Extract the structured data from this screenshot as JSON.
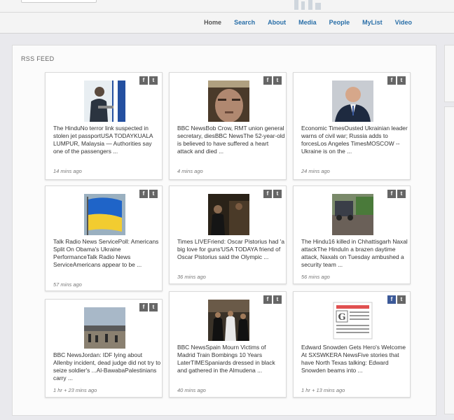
{
  "nav": {
    "items": [
      {
        "label": "Home",
        "active": true
      },
      {
        "label": "Search"
      },
      {
        "label": "About"
      },
      {
        "label": "Media"
      },
      {
        "label": "People"
      },
      {
        "label": "MyList"
      },
      {
        "label": "Video"
      }
    ]
  },
  "panel": {
    "title": "RSS FEED"
  },
  "social": {
    "facebook": "f",
    "twitter": "t"
  },
  "cards": [
    {
      "text": "The HinduNo terror link suspected in stolen jet passportUSA TODAYKUALA LUMPUR, Malaysia — Authorities say one of the passengers ...",
      "time": "14 mins ago"
    },
    {
      "text": "BBC NewsBob Crow, RMT union general secretary, diesBBC NewsThe 52-year-old is believed to have suffered a heart attack and died ...",
      "time": "4 mins ago"
    },
    {
      "text": "Economic TimesOusted Ukrainian leader warns of civil war; Russia adds to forcesLos Angeles TimesMOSCOW -- Ukraine is on the ...",
      "time": "24 mins ago"
    },
    {
      "text": "Talk Radio News ServicePoll: Americans Split On Obama's Ukraine PerformanceTalk Radio News ServiceAmericans appear to be ...",
      "time": "57 mins ago"
    },
    {
      "text": "Times LIVEFriend: Oscar Pistorius had 'a big love for guns'USA TODAYA friend of Oscar Pistorius said the Olympic ...",
      "time": "36 mins ago"
    },
    {
      "text": "The Hindu16 killed in Chhattisgarh Naxal attackThe HinduIn a brazen daytime attack, Naxals on Tuesday ambushed a security team ...",
      "time": "56 mins ago"
    },
    {
      "text": "BBC NewsJordan: IDF lying about Allenby incident, dead judge did not try to seize soldier's ...Al-BawabaPalestinians carry ...",
      "time": "1 hr + 23 mins ago"
    },
    {
      "text": "BBC NewsSpain Mourn Victims of Madrid Train Bombings 10 Years LaterTIMESpaniards dressed in black and gathered in the Almudena ...",
      "time": "40 mins ago"
    },
    {
      "text": "Edward Snowden Gets Hero's Welcome At SXSWKERA NewsFive stories that have North Texas talking: Edward Snowden beams into ...",
      "time": "1 hr + 13 mins ago"
    }
  ]
}
